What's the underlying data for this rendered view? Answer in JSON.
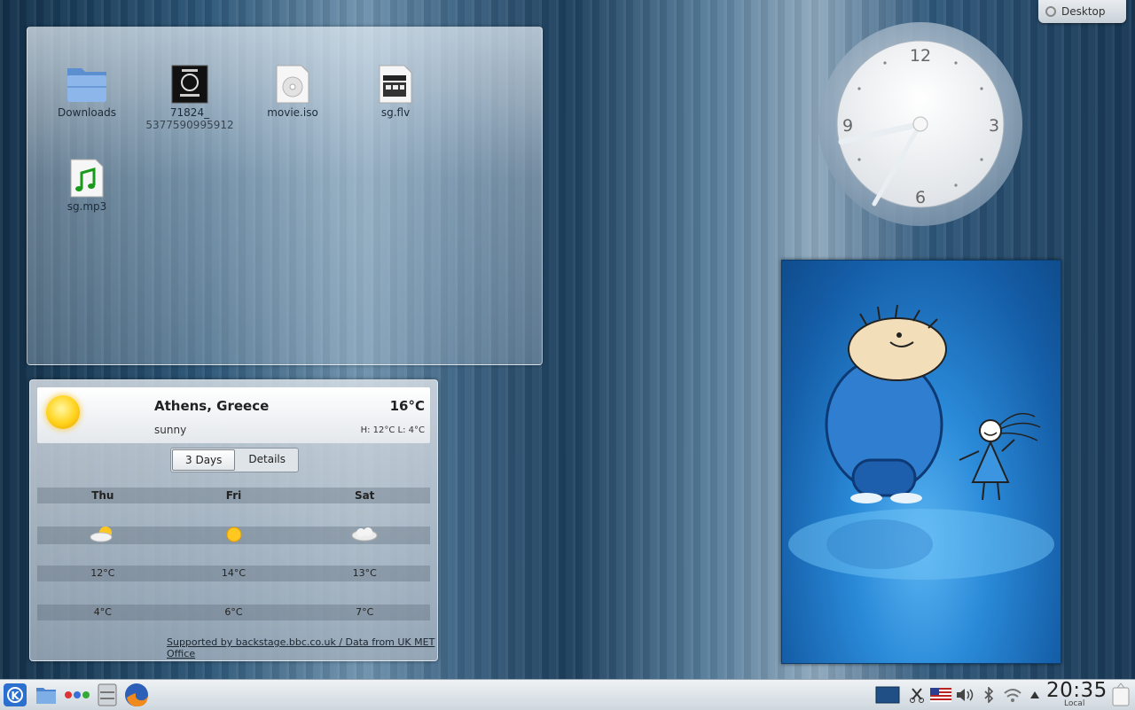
{
  "desktop_cashew": {
    "label": "Desktop"
  },
  "folder_view": {
    "items": [
      {
        "label": "Downloads",
        "icon": "folder-icon"
      },
      {
        "label_line1": "71824_",
        "label_line2": "5377590995912",
        "icon": "image-thumbnail-icon"
      },
      {
        "label": "movie.iso",
        "icon": "disc-image-icon"
      },
      {
        "label": "sg.flv",
        "icon": "video-file-icon"
      },
      {
        "label": "sg.mp3",
        "icon": "audio-file-icon"
      }
    ]
  },
  "weather": {
    "city": "Athens, Greece",
    "temperature": "16°C",
    "condition": "sunny",
    "high_low": "H: 12°C L: 4°C",
    "tabs": [
      "3 Days",
      "Details"
    ],
    "days": [
      "Thu",
      "Fri",
      "Sat"
    ],
    "day_icons": [
      "partly-cloudy-icon",
      "sun-icon",
      "cloud-icon"
    ],
    "highs": [
      "12°C",
      "14°C",
      "13°C"
    ],
    "lows": [
      "4°C",
      "6°C",
      "7°C"
    ],
    "footer": "Supported by backstage.bbc.co.uk / Data from UK MET Office"
  },
  "analog_clock": {
    "numerals": [
      "12",
      "3",
      "6",
      "9"
    ],
    "time": "20:35"
  },
  "taskbar": {
    "launchers": [
      "kde-menu-icon",
      "file-manager-icon",
      "activity-icon",
      "printer-icon",
      "firefox-icon"
    ],
    "tray": [
      "desktop-pager-icon",
      "clipboard-scissors-icon",
      "us-flag-keyboard-icon",
      "volume-icon",
      "bluetooth-icon",
      "wifi-icon",
      "expand-tray-icon"
    ],
    "clock_time": "20:35",
    "clock_zone": "Local"
  },
  "colors": {
    "accent": "#2a8ad8",
    "panel": "#dfe5ea"
  }
}
